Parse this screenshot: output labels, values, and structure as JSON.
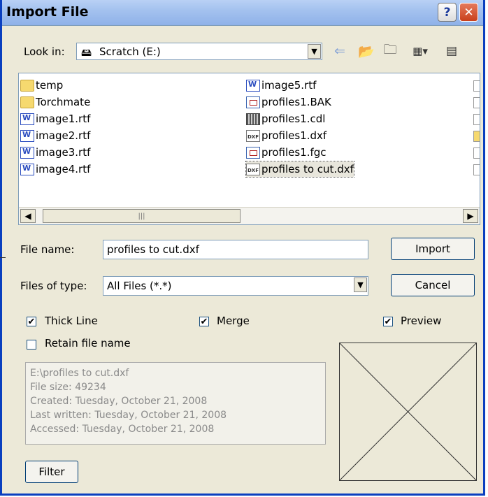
{
  "window": {
    "title": "Import File"
  },
  "lookin": {
    "label": "Look in:",
    "value": "Scratch (E:)"
  },
  "files": [
    {
      "name": "temp",
      "icon": "folder-icon"
    },
    {
      "name": "Torchmate",
      "icon": "folder-icon"
    },
    {
      "name": "image1.rtf",
      "icon": "rtf-file-icon"
    },
    {
      "name": "image2.rtf",
      "icon": "rtf-file-icon"
    },
    {
      "name": "image3.rtf",
      "icon": "rtf-file-icon"
    },
    {
      "name": "image4.rtf",
      "icon": "rtf-file-icon"
    },
    {
      "name": "image5.rtf",
      "icon": "rtf-file-icon"
    },
    {
      "name": "profiles1.BAK",
      "icon": "bak-file-icon"
    },
    {
      "name": "profiles1.cdl",
      "icon": "cdl-file-icon"
    },
    {
      "name": "profiles1.dxf",
      "icon": "dxf-file-icon"
    },
    {
      "name": "profiles1.fgc",
      "icon": "fgc-file-icon"
    },
    {
      "name": "profiles to cut.dxf",
      "icon": "dxf-file-icon"
    }
  ],
  "filename": {
    "label": "File name:",
    "value": "profiles to cut.dxf"
  },
  "filetype": {
    "label": "Files of type:",
    "value": "All Files (*.*)"
  },
  "buttons": {
    "import": "Import",
    "cancel": "Cancel",
    "filter": "Filter"
  },
  "options": {
    "thick_line": {
      "label": "Thick Line",
      "checked": true
    },
    "merge": {
      "label": "Merge",
      "checked": true
    },
    "preview": {
      "label": "Preview",
      "checked": true
    },
    "retain": {
      "label": "Retain file name",
      "checked": false
    }
  },
  "info": {
    "path": "E:\\profiles to cut.dxf",
    "size": "File size: 49234",
    "created": "Created: Tuesday, October 21, 2008",
    "written": "Last written: Tuesday, October 21, 2008",
    "accessed": "Accessed: Tuesday, October 21, 2008"
  },
  "check_mark": "✔"
}
